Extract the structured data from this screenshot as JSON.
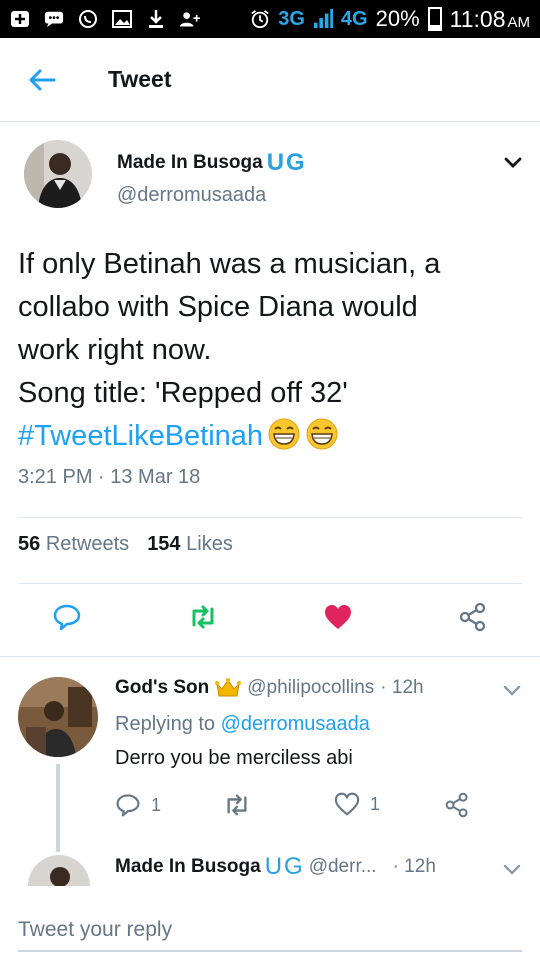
{
  "status_bar": {
    "network_3g": "3G",
    "network_4g": "4G",
    "battery": "20%",
    "time": "11:08",
    "ampm": "AM"
  },
  "header": {
    "title": "Tweet"
  },
  "tweet": {
    "author_name": "Made In Busoga",
    "author_suffix_u": "U",
    "author_suffix_g": "G",
    "handle": "@derromusaada",
    "text_line1": "If only Betinah was a musician, a",
    "text_line2": "collabo with Spice Diana would",
    "text_line3": "work right now.",
    "text_line4": "Song title: 'Repped off 32'",
    "hashtag": "#TweetLikeBetinah",
    "timestamp": "3:21 PM · 13 Mar 18",
    "retweets_count": "56",
    "retweets_label": "Retweets",
    "likes_count": "154",
    "likes_label": "Likes"
  },
  "reply": {
    "name": "God's Son",
    "handle": "@philipocollins",
    "time": "· 12h",
    "replying_prefix": "Replying to",
    "replying_handle": "@derromusaada",
    "text": "Derro you be merciless abi",
    "reply_count": "1",
    "like_count": "1"
  },
  "reply2": {
    "name": "Made In Busoga",
    "suffix_u": "U",
    "suffix_g": "G",
    "handle": "@derr...",
    "time": "· 12h"
  },
  "compose": {
    "placeholder": "Tweet your reply"
  },
  "colors": {
    "accent": "#1da1f2",
    "retweet": "#17bf63",
    "like": "#e0245e",
    "muted": "#657786"
  },
  "icons": [
    "back-arrow-icon",
    "chevron-down-icon",
    "reply-icon",
    "retweet-icon",
    "heart-icon",
    "share-icon",
    "crown-icon",
    "laughing-emoji-icon"
  ]
}
